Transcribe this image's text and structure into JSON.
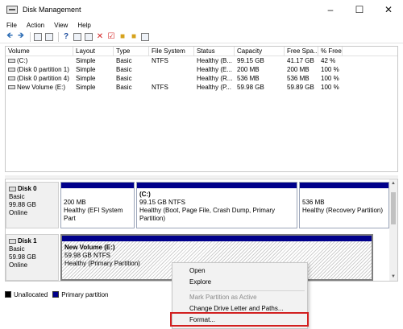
{
  "window": {
    "title": "Disk Management",
    "minimize_icon": "minimize-icon",
    "maximize_icon": "maximize-icon",
    "close_icon": "close-icon"
  },
  "menu": [
    "File",
    "Action",
    "View",
    "Help"
  ],
  "volume_table": {
    "columns": [
      "Volume",
      "Layout",
      "Type",
      "File System",
      "Status",
      "Capacity",
      "Free Spa...",
      "% Free"
    ],
    "rows": [
      {
        "volume": "(C:)",
        "layout": "Simple",
        "type": "Basic",
        "fs": "NTFS",
        "status": "Healthy (B...",
        "capacity": "99.15 GB",
        "free": "41.17 GB",
        "pct": "42 %"
      },
      {
        "volume": "(Disk 0 partition 1)",
        "layout": "Simple",
        "type": "Basic",
        "fs": "",
        "status": "Healthy (E...",
        "capacity": "200 MB",
        "free": "200 MB",
        "pct": "100 %"
      },
      {
        "volume": "(Disk 0 partition 4)",
        "layout": "Simple",
        "type": "Basic",
        "fs": "",
        "status": "Healthy (R...",
        "capacity": "536 MB",
        "free": "536 MB",
        "pct": "100 %"
      },
      {
        "volume": "New Volume (E:)",
        "layout": "Simple",
        "type": "Basic",
        "fs": "NTFS",
        "status": "Healthy (P...",
        "capacity": "59.98 GB",
        "free": "59.89 GB",
        "pct": "100 %"
      }
    ]
  },
  "disks": [
    {
      "name": "Disk 0",
      "type": "Basic",
      "size": "99.88 GB",
      "status": "Online",
      "partitions": [
        {
          "title": "",
          "size_line": "200 MB",
          "status_line": "Healthy (EFI System Part"
        },
        {
          "title": "(C:)",
          "size_line": "99.15 GB NTFS",
          "status_line": "Healthy (Boot, Page File, Crash Dump, Primary Partition)"
        },
        {
          "title": "",
          "size_line": "536 MB",
          "status_line": "Healthy (Recovery Partition)"
        }
      ]
    },
    {
      "name": "Disk 1",
      "type": "Basic",
      "size": "59.98 GB",
      "status": "Online",
      "partitions": [
        {
          "title": "New Volume  (E:)",
          "size_line": "59.98 GB NTFS",
          "status_line": "Healthy (Primary Partition)"
        }
      ]
    }
  ],
  "legend": [
    {
      "label": "Unallocated",
      "color": "#000000"
    },
    {
      "label": "Primary partition",
      "color": "#00008b"
    }
  ],
  "context_menu": {
    "items": [
      {
        "label": "Open",
        "enabled": true
      },
      {
        "label": "Explore",
        "enabled": true
      },
      {
        "label": "Mark Partition as Active",
        "enabled": false
      },
      {
        "label": "Change Drive Letter and Paths...",
        "enabled": true
      },
      {
        "label": "Format...",
        "enabled": true
      }
    ],
    "highlighted": "Format..."
  },
  "colors": {
    "partition_bar": "#00008b",
    "highlight_border": "#d21f1f"
  }
}
